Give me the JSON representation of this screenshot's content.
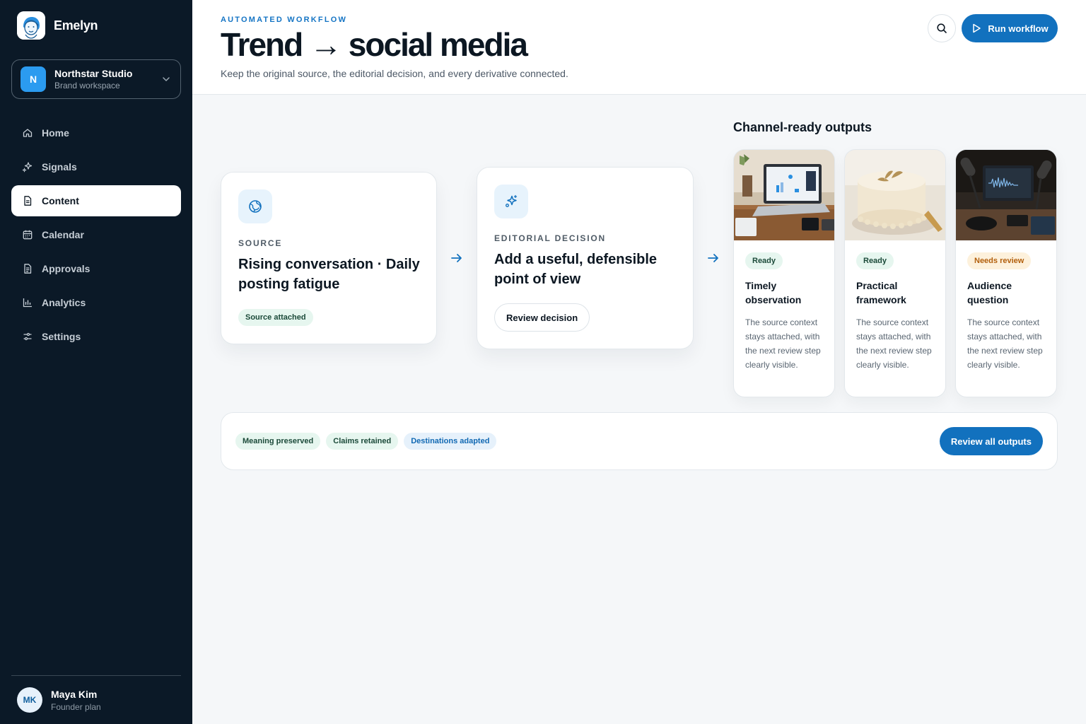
{
  "app": {
    "name": "Emelyn"
  },
  "workspace": {
    "initial": "N",
    "name": "Northstar Studio",
    "subtitle": "Brand workspace"
  },
  "nav": {
    "items": [
      {
        "label": "Home",
        "icon": "home-icon"
      },
      {
        "label": "Signals",
        "icon": "sparkle-icon"
      },
      {
        "label": "Content",
        "icon": "document-icon",
        "active": true
      },
      {
        "label": "Calendar",
        "icon": "calendar-icon"
      },
      {
        "label": "Approvals",
        "icon": "document-check-icon"
      },
      {
        "label": "Analytics",
        "icon": "bar-chart-icon"
      },
      {
        "label": "Settings",
        "icon": "sliders-icon"
      }
    ]
  },
  "user": {
    "initials": "MK",
    "name": "Maya Kim",
    "plan": "Founder plan"
  },
  "header": {
    "eyebrow": "AUTOMATED WORKFLOW",
    "title": "Trend → social media",
    "subtitle": "Keep the original source, the editorial decision, and every derivative connected.",
    "run_label": "Run workflow"
  },
  "source": {
    "kicker": "SOURCE",
    "title": "Rising conversation · Daily posting fatigue",
    "chip": "Source attached"
  },
  "decision": {
    "kicker": "EDITORIAL DECISION",
    "title": "Add a useful, defensible point of view",
    "button": "Review decision"
  },
  "outputs": {
    "heading": "Channel-ready outputs",
    "items": [
      {
        "status": "Ready",
        "title": "Timely observation",
        "body": "The source context stays attached, with the next review step clearly visible.",
        "image": "laptop-desk-photo"
      },
      {
        "status": "Ready",
        "title": "Practical framework",
        "body": "The source context stays attached, with the next review step clearly visible.",
        "image": "cake-photo"
      },
      {
        "status": "Needs review",
        "title": "Audience question",
        "body": "The source context stays attached, with the next review step clearly visible.",
        "image": "podcast-mic-photo"
      }
    ]
  },
  "footer": {
    "chips": [
      "Meaning preserved",
      "Claims retained",
      "Destinations adapted"
    ],
    "button": "Review all outputs"
  },
  "colors": {
    "sidebar": "#0b1927",
    "accent": "#1271be",
    "ready": "#e6f6ef",
    "needs_review": "#fdf1dc"
  }
}
